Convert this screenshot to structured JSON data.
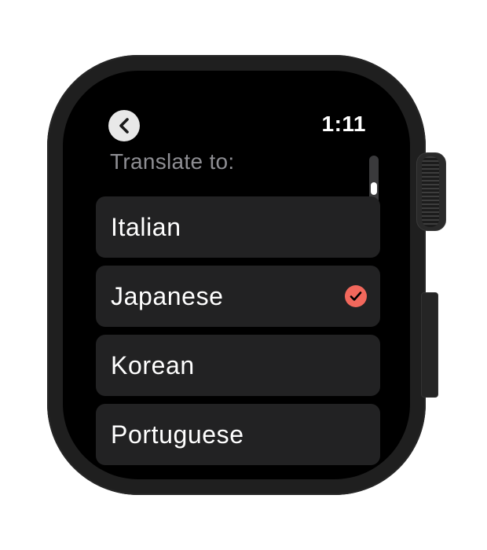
{
  "status": {
    "time": "1:11"
  },
  "header": {
    "back_icon": "chevron-left-icon",
    "title": "Translate to:"
  },
  "scroll": {
    "position_fraction": 0.5
  },
  "colors": {
    "accent": "#f2685c",
    "row_background": "#222223",
    "label_gray": "#8e8e93"
  },
  "languages": [
    {
      "label": "Italian",
      "selected": false
    },
    {
      "label": "Japanese",
      "selected": true
    },
    {
      "label": "Korean",
      "selected": false
    },
    {
      "label": "Portuguese",
      "selected": false
    }
  ]
}
